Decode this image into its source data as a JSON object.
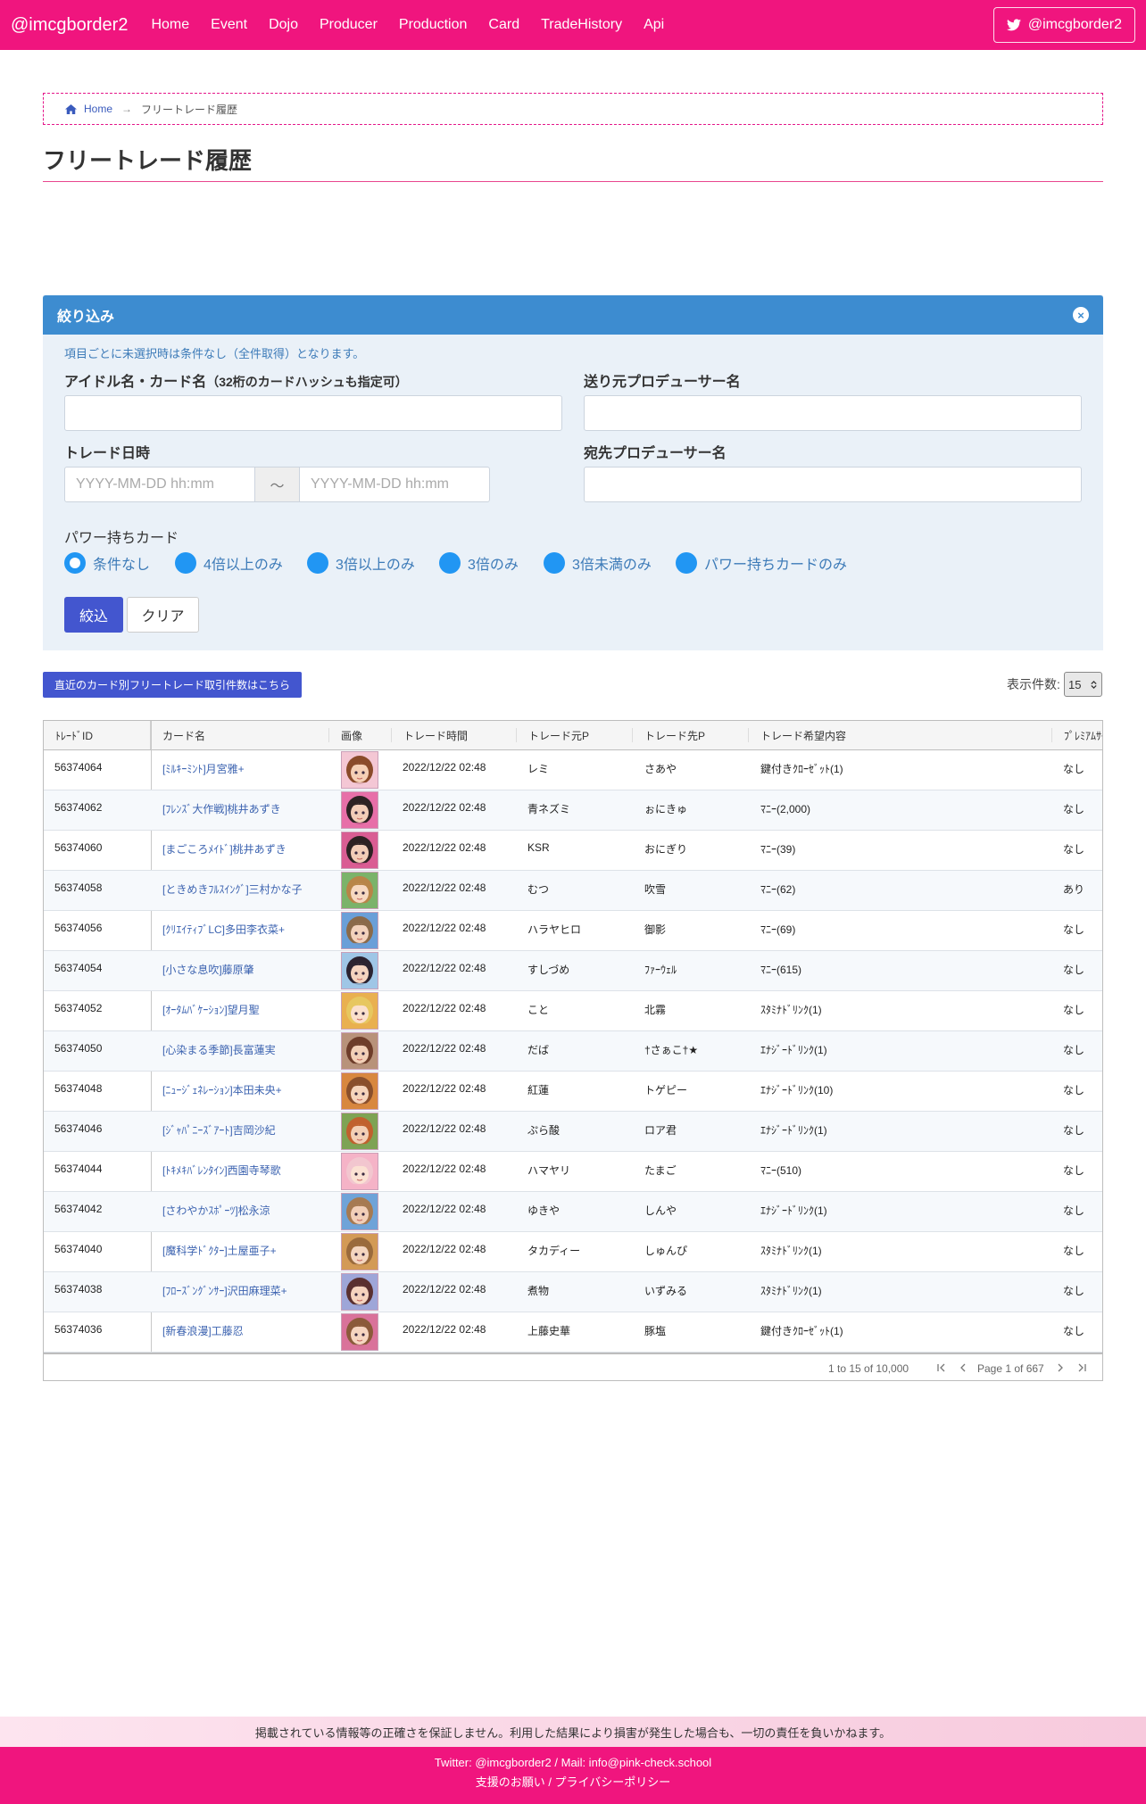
{
  "navbar": {
    "brand": "@imcgborder2",
    "items": [
      "Home",
      "Event",
      "Dojo",
      "Producer",
      "Production",
      "Card",
      "TradeHistory",
      "Api"
    ],
    "twitter_label": "@imcgborder2"
  },
  "breadcrumb": {
    "home": "Home",
    "separator": "→",
    "current": "フリートレード履歴"
  },
  "page_title": "フリートレード履歴",
  "filter": {
    "header": "絞り込み",
    "close_symbol": "×",
    "note": "項目ごとに未選択時は条件なし（全件取得）となります。",
    "idol_label": "アイドル名・カード名",
    "idol_label_sub": "（32桁のカードハッシュも指定可）",
    "idol_value": "",
    "sender_label": "送り元プロデューサー名",
    "sender_value": "",
    "date_label": "トレード日時",
    "date_from_placeholder": "YYYY-MM-DD hh:mm",
    "date_separator": "～",
    "date_to_placeholder": "YYYY-MM-DD hh:mm",
    "receiver_label": "宛先プロデューサー名",
    "receiver_value": "",
    "power_label": "パワー持ちカード",
    "power_options": [
      {
        "label": "条件なし",
        "checked": true
      },
      {
        "label": "4倍以上のみ",
        "checked": false
      },
      {
        "label": "3倍以上のみ",
        "checked": false
      },
      {
        "label": "3倍のみ",
        "checked": false
      },
      {
        "label": "3倍未満のみ",
        "checked": false
      },
      {
        "label": "パワー持ちカードのみ",
        "checked": false
      }
    ],
    "apply_label": "絞込",
    "clear_label": "クリア"
  },
  "actions": {
    "card_count_link": "直近のカード別フリートレード取引件数はこちら",
    "page_size_label": "表示件数:",
    "page_size_value": "15"
  },
  "grid": {
    "columns": [
      "ﾄﾚｰﾄﾞID",
      "カード名",
      "画像",
      "トレード時間",
      "トレード元P",
      "トレード先P",
      "トレード希望内容",
      "ﾌﾟﾚﾐｱﾑｻｲﾝ"
    ],
    "rows": [
      {
        "id": "56374064",
        "card": "[ﾐﾙｷｰﾐﾝﾄ]月宮雅+",
        "time": "2022/12/22 02:48",
        "from": "レミ",
        "to": "さあや",
        "want": "鍵付きｸﾛｰｾﾞｯﾄ(1)",
        "premium": "なし",
        "skin": "#f5d0b5",
        "hair": "#8a4b2a",
        "bg": "#f4c7d4"
      },
      {
        "id": "56374062",
        "card": "[ﾌﾚﾝｽﾞ大作戦]桃井あずき",
        "time": "2022/12/22 02:48",
        "from": "青ネズミ",
        "to": "ぉにきゅ",
        "want": "ﾏﾆｰ(2,000)",
        "premium": "なし",
        "skin": "#f2cdb7",
        "hair": "#2d2223",
        "bg": "#e76fa8"
      },
      {
        "id": "56374060",
        "card": "[まごころﾒｲﾄﾞ]桃井あずき",
        "time": "2022/12/22 02:48",
        "from": "KSR",
        "to": "おにぎり",
        "want": "ﾏﾆｰ(39)",
        "premium": "なし",
        "skin": "#f2cdb7",
        "hair": "#2d2223",
        "bg": "#d95d93"
      },
      {
        "id": "56374058",
        "card": "[ときめきﾌﾙｽｲﾝｸﾞ]三村かな子",
        "time": "2022/12/22 02:48",
        "from": "むつ",
        "to": "吹雪",
        "want": "ﾏﾆｰ(62)",
        "premium": "あり",
        "skin": "#f7d8c0",
        "hair": "#b88548",
        "bg": "#7bb36a"
      },
      {
        "id": "56374056",
        "card": "[ｸﾘｴｲﾃｨﾌﾞLC]多田李衣菜+",
        "time": "2022/12/22 02:48",
        "from": "ハラヤヒロ",
        "to": "御影",
        "want": "ﾏﾆｰ(69)",
        "premium": "なし",
        "skin": "#f3d2bc",
        "hair": "#8b6a4a",
        "bg": "#6a9fd8"
      },
      {
        "id": "56374054",
        "card": "[小さな息吹]藤原肇",
        "time": "2022/12/22 02:48",
        "from": "すしづめ",
        "to": "ﾌｧｰｳｪﾙ",
        "want": "ﾏﾆｰ(615)",
        "premium": "なし",
        "skin": "#f4d3bf",
        "hair": "#2b2330",
        "bg": "#9fc6e6"
      },
      {
        "id": "56374052",
        "card": "[ｵｰﾀﾑﾊﾞｹｰｼｮﾝ]望月聖",
        "time": "2022/12/22 02:48",
        "from": "こと",
        "to": "北霧",
        "want": "ｽﾀﾐﾅﾄﾞﾘﾝｸ(1)",
        "premium": "なし",
        "skin": "#fbe0cc",
        "hair": "#e7c760",
        "bg": "#e9b050"
      },
      {
        "id": "56374050",
        "card": "[心染まる季節]長富蓮実",
        "time": "2022/12/22 02:48",
        "from": "だば",
        "to": "†さぁこ†★",
        "want": "ｴﾅｼﾞｰﾄﾞﾘﾝｸ(1)",
        "premium": "なし",
        "skin": "#f2cfb6",
        "hair": "#6e3d2a",
        "bg": "#b8927a"
      },
      {
        "id": "56374048",
        "card": "[ﾆｭｰｼﾞｪﾈﾚｰｼｮﾝ]本田未央+",
        "time": "2022/12/22 02:48",
        "from": "紅蓮",
        "to": "トゲピー",
        "want": "ｴﾅｼﾞｰﾄﾞﾘﾝｸ(10)",
        "premium": "なし",
        "skin": "#f6d4bb",
        "hair": "#8a4f2c",
        "bg": "#d8873f"
      },
      {
        "id": "56374046",
        "card": "[ｼﾞｬﾊﾟﾆｰｽﾞｱｰﾄ]吉岡沙紀",
        "time": "2022/12/22 02:48",
        "from": "ぷら酸",
        "to": "ロア君",
        "want": "ｴﾅｼﾞｰﾄﾞﾘﾝｸ(1)",
        "premium": "なし",
        "skin": "#f3cfb5",
        "hair": "#c0612e",
        "bg": "#7ea354"
      },
      {
        "id": "56374044",
        "card": "[ﾄｷﾒｷﾊﾞﾚﾝﾀｲﾝ]西園寺琴歌",
        "time": "2022/12/22 02:48",
        "from": "ハマヤリ",
        "to": "たまご",
        "want": "ﾏﾆｰ(510)",
        "premium": "なし",
        "skin": "#fbe1d3",
        "hair": "#f2c6cf",
        "bg": "#f5b3c7"
      },
      {
        "id": "56374042",
        "card": "[さわやかｽﾎﾟｰﾂ]松永涼",
        "time": "2022/12/22 02:48",
        "from": "ゆきや",
        "to": "しんや",
        "want": "ｴﾅｼﾞｰﾄﾞﾘﾝｸ(1)",
        "premium": "なし",
        "skin": "#f2cfb8",
        "hair": "#a67a52",
        "bg": "#6fa3d8"
      },
      {
        "id": "56374040",
        "card": "[魔科学ﾄﾞｸﾀｰ]土屋亜子+",
        "time": "2022/12/22 02:48",
        "from": "タカディー",
        "to": "しゅんぴ",
        "want": "ｽﾀﾐﾅﾄﾞﾘﾝｸ(1)",
        "premium": "なし",
        "skin": "#f4d5bf",
        "hair": "#9a6a3c",
        "bg": "#d39a56"
      },
      {
        "id": "56374038",
        "card": "[ﾌﾛｰｽﾞﾝｸﾞﾝｻｰ]沢田麻理菜+",
        "time": "2022/12/22 02:48",
        "from": "煮物",
        "to": "いずみる",
        "want": "ｽﾀﾐﾅﾄﾞﾘﾝｸ(1)",
        "premium": "なし",
        "skin": "#f5d3be",
        "hair": "#5a3030",
        "bg": "#9ea6d8"
      },
      {
        "id": "56374036",
        "card": "[新春浪漫]工藤忍",
        "time": "2022/12/22 02:48",
        "from": "上藤史華",
        "to": "豚塩",
        "want": "鍵付きｸﾛｰｾﾞｯﾄ(1)",
        "premium": "なし",
        "skin": "#f6d5c0",
        "hair": "#8b5a3a",
        "bg": "#d9729a"
      }
    ],
    "summary": "1 to 15 of 10,000",
    "page_info": "Page 1 of 667"
  },
  "footer": {
    "disclaimer": "掲載されている情報等の正確さを保証しません。利用した結果により損害が発生した場合も、一切の責任を負いかねます。",
    "contact_text": "Twitter: @imcgborder2 / Mail: info@pink-check.school",
    "support_link": "支援のお願い",
    "link_separator": " / ",
    "privacy_link": "プライバシーポリシー"
  },
  "colors": {
    "brand": "#f0157e",
    "panel_header": "#3d8cd0",
    "primary_button": "#4356cf",
    "radio": "#2196f3"
  }
}
